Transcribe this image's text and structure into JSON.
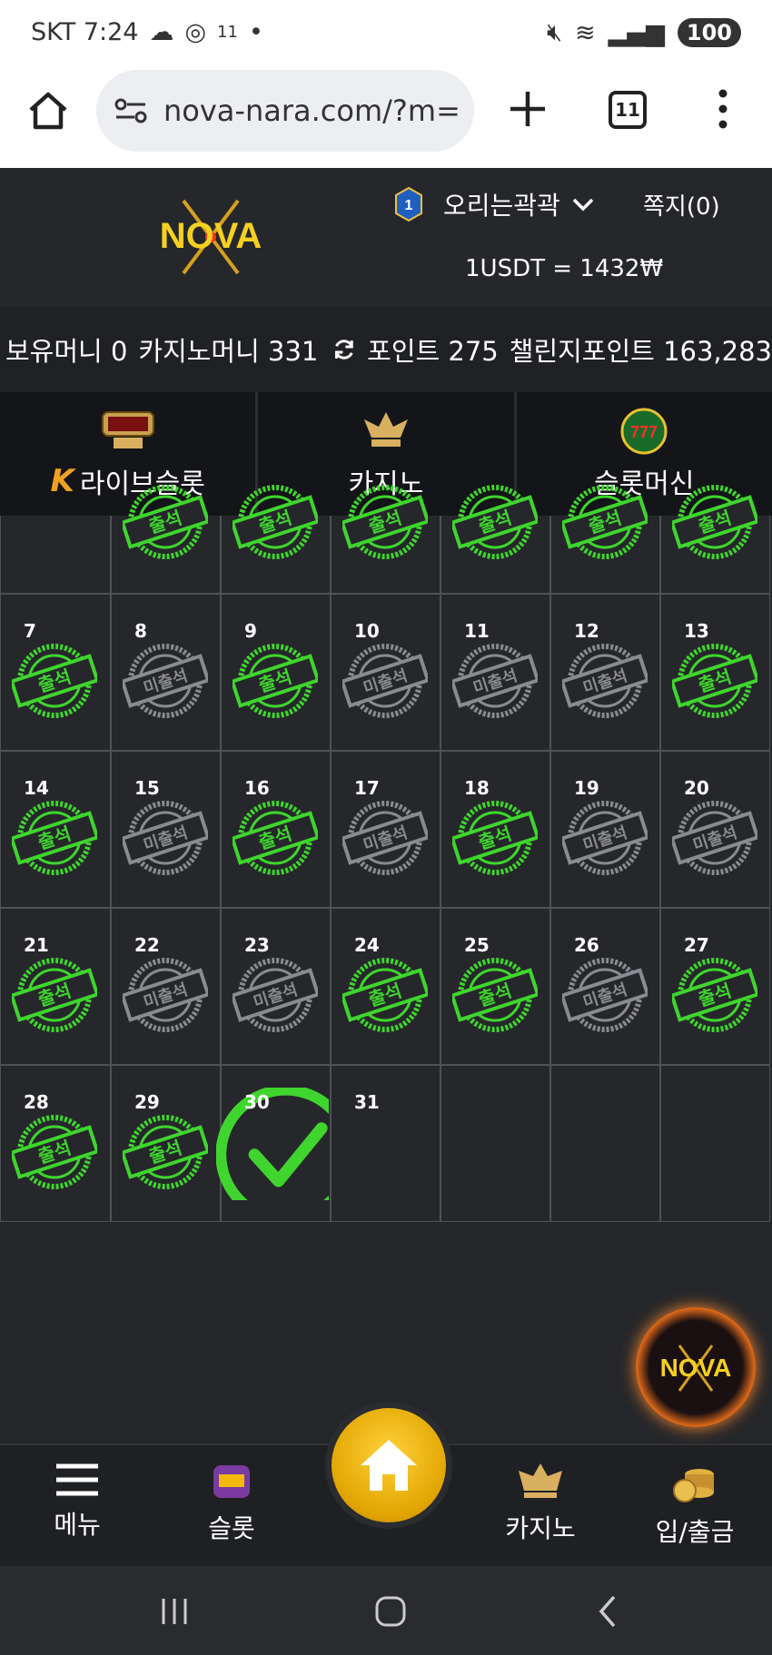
{
  "status_bar": {
    "carrier_time": "SKT 7:24",
    "extra": "11",
    "battery": "100"
  },
  "browser": {
    "url": "nova-nara.com/?m=",
    "tab_count": "11"
  },
  "header": {
    "logo_text": "NOVA",
    "level": "1",
    "username": "오리는곽곽",
    "messages_label": "쪽지(0)",
    "exchange_rate": "1USDT = 1432₩"
  },
  "balance": {
    "holding": "보유머니 0",
    "casino": "카지노머니 331",
    "point": "포인트 275",
    "challenge": "챌린지포인트 163,283"
  },
  "categories": [
    {
      "label": "라이브슬롯",
      "icon": "live-slot-icon",
      "prefix": "K"
    },
    {
      "label": "카지노",
      "icon": "k-slot-icon"
    },
    {
      "label": "슬롯머신",
      "icon": "777-slots-icon"
    }
  ],
  "calendar": {
    "attended_label": "출석",
    "absent_label": "미출석",
    "first_row": [
      "",
      "present",
      "present",
      "present",
      "present",
      "present",
      "present"
    ],
    "weeks": [
      [
        {
          "day": "7",
          "s": "present"
        },
        {
          "day": "8",
          "s": "absent"
        },
        {
          "day": "9",
          "s": "present"
        },
        {
          "day": "10",
          "s": "absent"
        },
        {
          "day": "11",
          "s": "absent"
        },
        {
          "day": "12",
          "s": "absent"
        },
        {
          "day": "13",
          "s": "present"
        }
      ],
      [
        {
          "day": "14",
          "s": "present"
        },
        {
          "day": "15",
          "s": "absent"
        },
        {
          "day": "16",
          "s": "present"
        },
        {
          "day": "17",
          "s": "absent"
        },
        {
          "day": "18",
          "s": "present"
        },
        {
          "day": "19",
          "s": "absent"
        },
        {
          "day": "20",
          "s": "absent"
        }
      ],
      [
        {
          "day": "21",
          "s": "present"
        },
        {
          "day": "22",
          "s": "absent"
        },
        {
          "day": "23",
          "s": "absent"
        },
        {
          "day": "24",
          "s": "present"
        },
        {
          "day": "25",
          "s": "present"
        },
        {
          "day": "26",
          "s": "absent"
        },
        {
          "day": "27",
          "s": "present"
        }
      ],
      [
        {
          "day": "28",
          "s": "present"
        },
        {
          "day": "29",
          "s": "present"
        },
        {
          "day": "30",
          "s": "check"
        },
        {
          "day": "31",
          "s": "none"
        },
        {
          "day": "",
          "s": "none"
        },
        {
          "day": "",
          "s": "none"
        },
        {
          "day": "",
          "s": "none"
        }
      ]
    ]
  },
  "bottom_nav": {
    "menu": "메뉴",
    "slot": "슬롯",
    "casino": "카지노",
    "deposit": "입/출금"
  },
  "colors": {
    "present": "#3fd52e",
    "absent": "#8a8b90",
    "accent": "#f2b90c"
  }
}
